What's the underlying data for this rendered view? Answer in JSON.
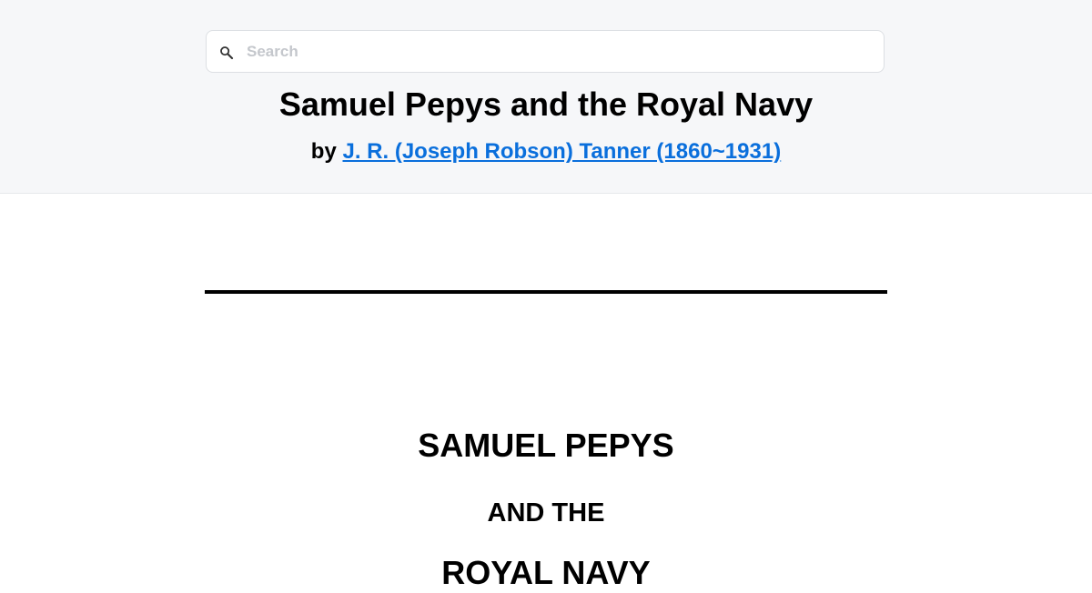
{
  "search": {
    "placeholder": "Search",
    "icon": "search-icon"
  },
  "book": {
    "title": "Samuel Pepys and the Royal Navy",
    "by_label": "by",
    "author": "J. R. (Joseph Robson) Tanner (1860~1931)"
  },
  "content": {
    "heading_line1": "SAMUEL PEPYS",
    "heading_line2": "AND THE",
    "heading_line3": "ROYAL NAVY"
  },
  "colors": {
    "header_bg": "#f6f7f9",
    "link": "#0a6fdc",
    "text": "#000000"
  }
}
